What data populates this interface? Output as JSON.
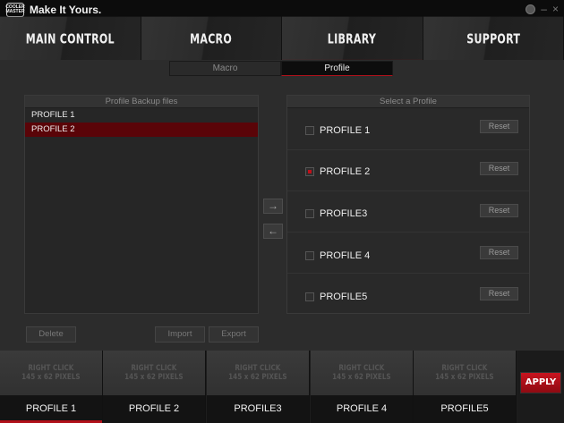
{
  "app": {
    "logo_text": "COOLER MASTER",
    "title": "Make It Yours.",
    "minimize": "–",
    "close": "×"
  },
  "nav": {
    "tabs": [
      {
        "label": "MAIN CONTROL"
      },
      {
        "label": "MACRO"
      },
      {
        "label": "LIBRARY"
      },
      {
        "label": "SUPPORT"
      }
    ],
    "active": "LIBRARY"
  },
  "subtabs": {
    "items": [
      {
        "label": "Macro"
      },
      {
        "label": "Profile"
      }
    ],
    "active": "Profile"
  },
  "backup": {
    "header": "Profile Backup files",
    "items": [
      "PROFILE 1",
      "PROFILE 2"
    ],
    "selected": "PROFILE 2"
  },
  "select": {
    "header": "Select a Profile",
    "profiles": [
      {
        "label": "PROFILE 1",
        "checked": false
      },
      {
        "label": "PROFILE 2",
        "checked": true
      },
      {
        "label": "PROFILE3",
        "checked": false
      },
      {
        "label": "PROFILE 4",
        "checked": false
      },
      {
        "label": "PROFILE5",
        "checked": false
      }
    ],
    "reset_label": "Reset"
  },
  "arrows": {
    "right": "→",
    "left": "←"
  },
  "actions": {
    "delete": "Delete",
    "import": "Import",
    "export": "Export"
  },
  "strip": {
    "placeholder_line1": "RIGHT CLICK",
    "placeholder_line2": "145 x 62 PIXELS",
    "slots": [
      "PROFILE 1",
      "PROFILE 2",
      "PROFILE3",
      "PROFILE 4",
      "PROFILE5"
    ],
    "active": "PROFILE 1",
    "apply": "APPLY"
  },
  "colors": {
    "accent": "#b0101a",
    "selected_row": "#5a0408"
  }
}
